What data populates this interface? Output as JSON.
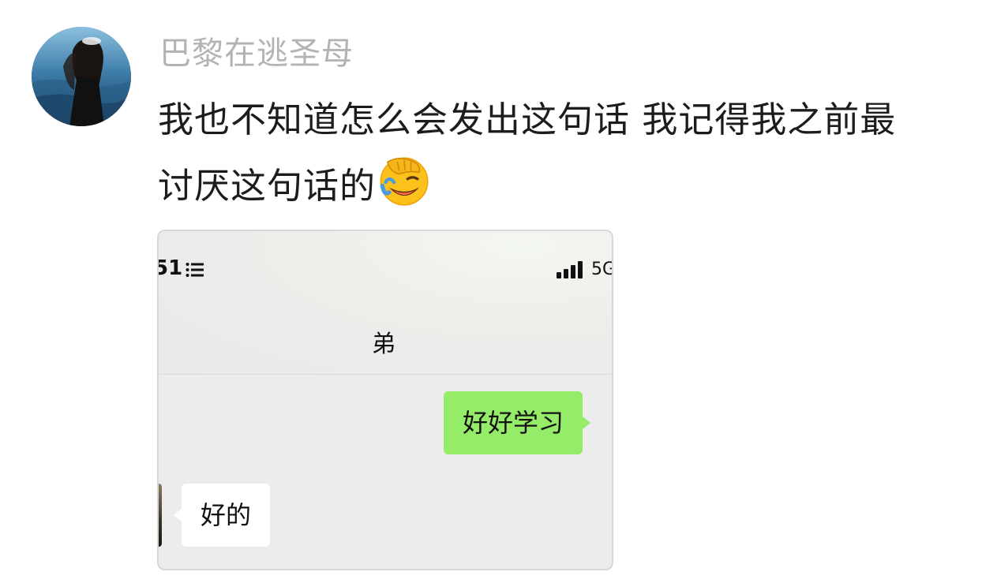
{
  "post": {
    "username": "巴黎在逃圣母",
    "text": "我也不知道怎么会发出这句话 我记得我之前最讨厌这句话的",
    "emoji": "face-palm-laughing-emoji"
  },
  "screenshot": {
    "status_time": "51",
    "network": "5G",
    "chat_title": "弟",
    "messages": [
      {
        "side": "sent",
        "text": "好好学习"
      },
      {
        "side": "received",
        "text": "好的"
      }
    ]
  },
  "colors": {
    "username": "#b3b3b3",
    "sent_bubble": "#95ec69",
    "received_bubble": "#ffffff",
    "chat_background": "#ececec"
  }
}
